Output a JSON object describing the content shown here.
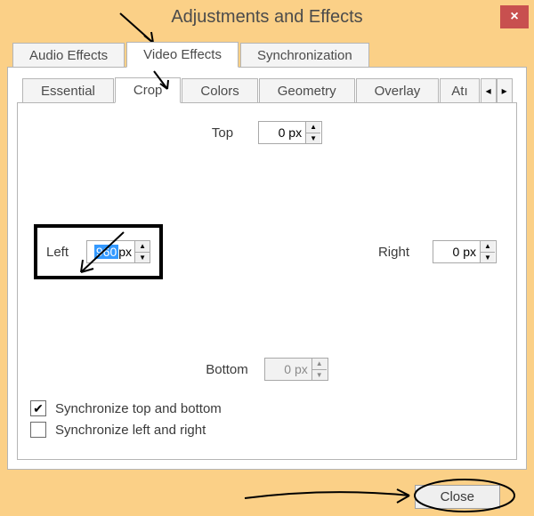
{
  "window": {
    "title": "Adjustments and Effects",
    "close_icon": "×"
  },
  "main_tabs": [
    {
      "label": "Audio Effects",
      "active": false
    },
    {
      "label": "Video Effects",
      "active": true
    },
    {
      "label": "Synchronization",
      "active": false
    }
  ],
  "sub_tabs": [
    {
      "label": "Essential",
      "active": false
    },
    {
      "label": "Crop",
      "active": true
    },
    {
      "label": "Colors",
      "active": false
    },
    {
      "label": "Geometry",
      "active": false
    },
    {
      "label": "Overlay",
      "active": false
    },
    {
      "label": "Atı",
      "active": false
    }
  ],
  "scroll": {
    "left": "◂",
    "right": "▸"
  },
  "crop": {
    "top_label": "Top",
    "top_value": "0 px",
    "left_label": "Left",
    "left_value_hl": "960",
    "left_value_unit": " px",
    "right_label": "Right",
    "right_value": "0 px",
    "bottom_label": "Bottom",
    "bottom_value": "0 px"
  },
  "checks": {
    "sync_tb_label": "Synchronize top and bottom",
    "sync_tb_checked": true,
    "sync_lr_label": "Synchronize left and right",
    "sync_lr_checked": false,
    "checkmark": "✔"
  },
  "footer": {
    "close_label": "Close"
  }
}
